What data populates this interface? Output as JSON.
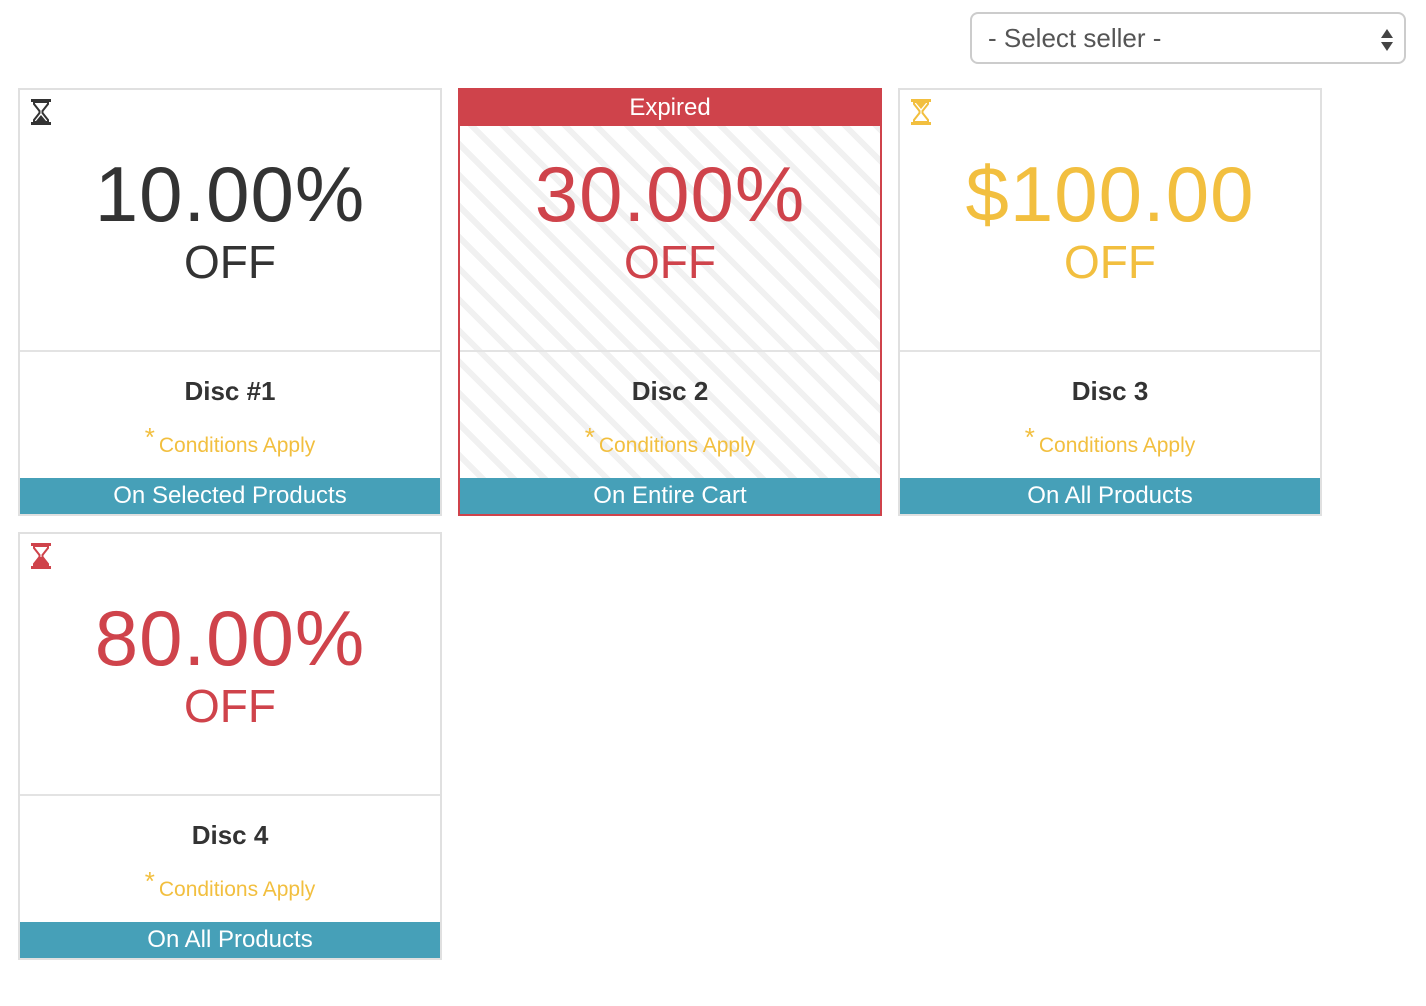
{
  "seller_select": {
    "selected": "- Select seller -"
  },
  "colors": {
    "dark": "#333333",
    "red": "#cf434b",
    "yellow": "#f2bf3f",
    "teal": "#46a0b8"
  },
  "cards": [
    {
      "amount": "10.00%",
      "off": "OFF",
      "name": "Disc #1",
      "conditions_star": "*",
      "conditions": "Conditions Apply",
      "scope": "On Selected Products",
      "icon": "hourglass-icon",
      "color": "dark"
    },
    {
      "banner": "Expired",
      "amount": "30.00%",
      "off": "OFF",
      "name": "Disc 2",
      "conditions_star": "*",
      "conditions": "Conditions Apply",
      "scope": "On Entire Cart",
      "color": "red"
    },
    {
      "amount": "$100.00",
      "off": "OFF",
      "name": "Disc 3",
      "conditions_star": "*",
      "conditions": "Conditions Apply",
      "scope": "On All Products",
      "icon": "hourglass-icon",
      "color": "yellow"
    },
    {
      "amount": "80.00%",
      "off": "OFF",
      "name": "Disc 4",
      "conditions_star": "*",
      "conditions": "Conditions Apply",
      "scope": "On All Products",
      "icon": "hourglass-icon",
      "color": "red"
    }
  ]
}
